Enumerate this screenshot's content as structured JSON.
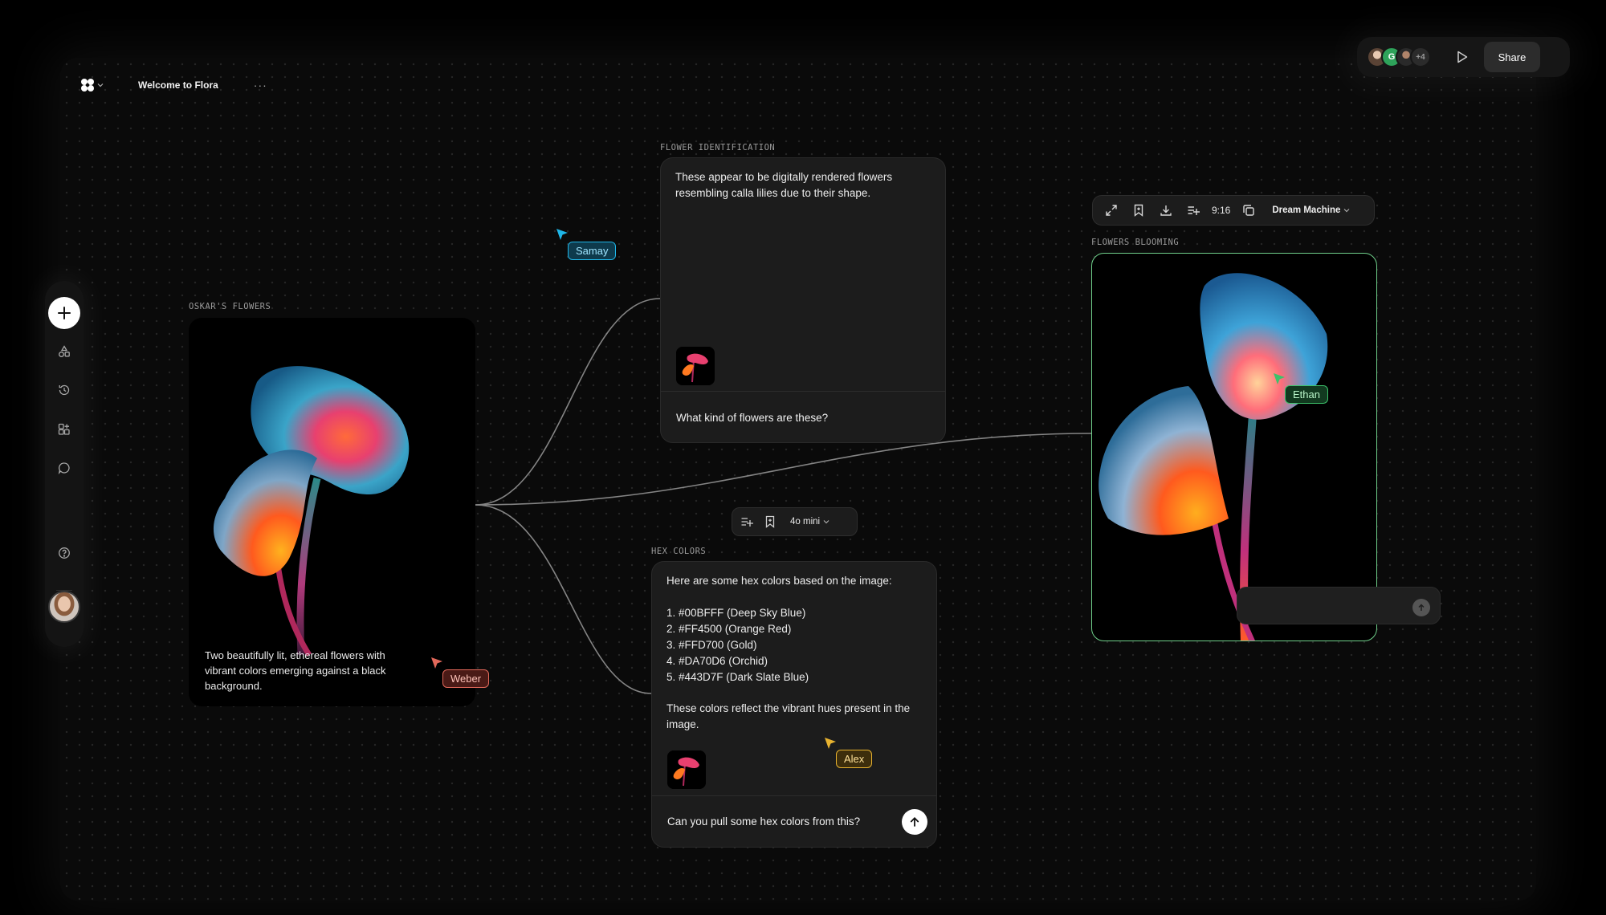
{
  "app": {
    "file_title": "Welcome to Flora",
    "more_label": "···"
  },
  "collaborators": {
    "avatars": [
      {
        "initial": ""
      },
      {
        "initial": "G"
      },
      {
        "initial": ""
      }
    ],
    "overflow_count": "+4",
    "share_label": "Share"
  },
  "nodes": {
    "oskars_flowers": {
      "label": "OSKAR'S FLOWERS",
      "caption": "Two beautifully lit, ethereal flowers with vibrant colors emerging against a black background."
    },
    "flower_identification": {
      "label": "FLOWER IDENTIFICATION",
      "response": "These appear to be digitally rendered flowers resembling calla lilies due to their shape.",
      "prompt": "What kind of flowers are these?"
    },
    "hex_colors": {
      "label": "HEX COLORS",
      "intro": "Here are some hex colors based on the image:",
      "colors": [
        "1. #00BFFF (Deep Sky Blue)",
        "2. #FF4500 (Orange Red)",
        "3. #FFD700 (Gold)",
        "4. #DA70D6 (Orchid)",
        "5. #443D7F (Dark Slate Blue)"
      ],
      "outro": "These colors reflect the vibrant hues present in the image.",
      "prompt": "Can you pull some hex colors from this?"
    },
    "flowers_blooming": {
      "label": "FLOWERS BLOOMING"
    }
  },
  "floating_bar": {
    "model": "4o mini"
  },
  "video_toolbar": {
    "ratio": "9:16",
    "model": "Dream Machine"
  },
  "cursors": [
    {
      "name": "Samay",
      "color": "#1fb6e8"
    },
    {
      "name": "Weber",
      "color": "#e2685a"
    },
    {
      "name": "Ethan",
      "color": "#3cc26a"
    },
    {
      "name": "Alex",
      "color": "#e8b330"
    }
  ],
  "icons": {
    "logo": "flora-logo-icon",
    "sidebar": [
      "plus-icon",
      "shapes-icon",
      "history-icon",
      "grid-plus-icon",
      "chat-icon",
      "help-icon"
    ],
    "toolbar": [
      "expand-icon",
      "bookmark-icon",
      "download-icon",
      "add-to-list-icon",
      "copy-icon"
    ]
  }
}
